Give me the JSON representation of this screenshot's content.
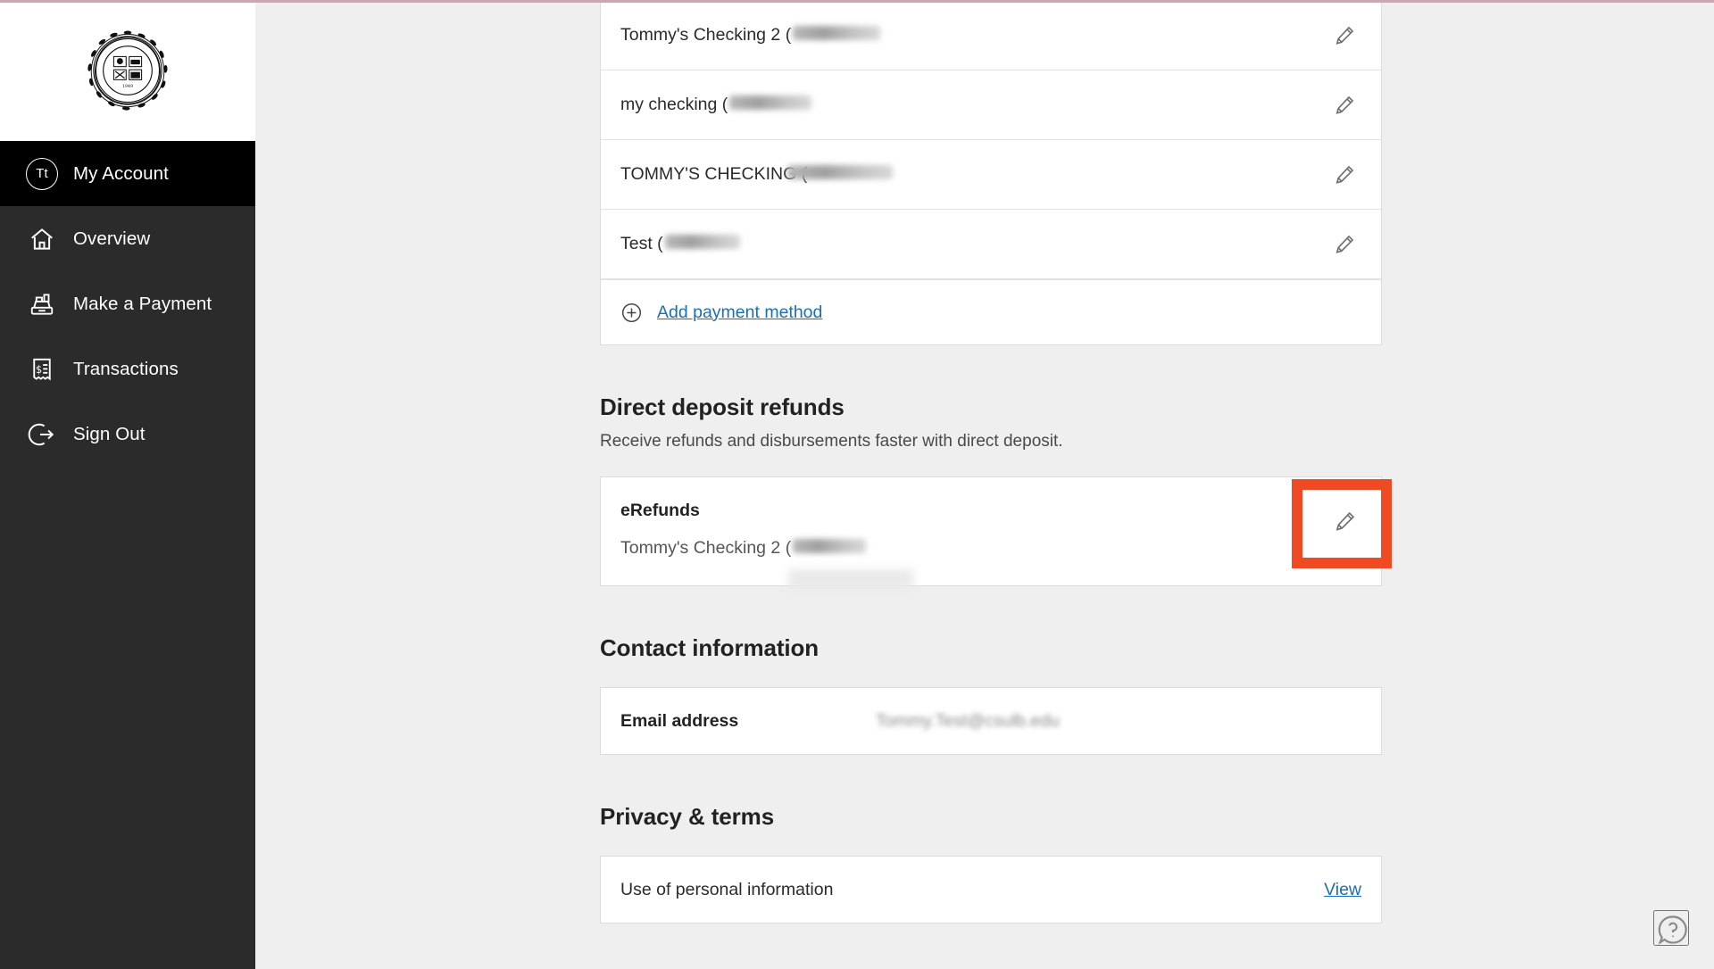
{
  "sidebar": {
    "logo_alt": "California State University Long Beach seal",
    "logo_text_top": "CALIFORNIA STATE UNIVERSITY",
    "logo_text_bottom": "LONG BEACH",
    "logo_year": "1949",
    "items": [
      {
        "label": "My Account",
        "icon": "avatar-icon",
        "badge": "Tt",
        "active": true
      },
      {
        "label": "Overview",
        "icon": "home-icon",
        "active": false
      },
      {
        "label": "Make a Payment",
        "icon": "register-icon",
        "active": false
      },
      {
        "label": "Transactions",
        "icon": "receipt-icon",
        "active": false
      },
      {
        "label": "Sign Out",
        "icon": "sign-out-icon",
        "active": false
      }
    ]
  },
  "payment_methods": {
    "rows": [
      {
        "name": "Tommy's Checking 2 (",
        "masked": "••••••6789)",
        "edit_icon": "pencil-icon"
      },
      {
        "name": "my checking (",
        "masked": "••••••6235)",
        "edit_icon": "pencil-icon"
      },
      {
        "name": "TOMMY'S CHECKING (",
        "masked": "••••••6789)",
        "edit_icon": "pencil-icon"
      },
      {
        "name": "Test (",
        "masked": "••••••3304)",
        "edit_icon": "pencil-icon"
      }
    ],
    "add_label": "Add payment method",
    "add_icon": "plus-circle-icon"
  },
  "direct_deposit": {
    "title": "Direct deposit refunds",
    "subtitle": "Receive refunds and disbursements faster with direct deposit.",
    "account_title": "eRefunds",
    "account_name": "Tommy's Checking 2 (",
    "account_masked": "•••••6789)",
    "edit_icon": "pencil-icon"
  },
  "contact": {
    "title": "Contact information",
    "email_label": "Email address",
    "email_value": "Tommy.Test@csulb.edu"
  },
  "privacy": {
    "title": "Privacy & terms",
    "row_label": "Use of personal information",
    "view_label": "View"
  },
  "help": {
    "icon": "help-question-icon",
    "label": "Help"
  },
  "colors": {
    "sidebar_bg": "#2b2b2b",
    "sidebar_active_bg": "#000000",
    "page_bg": "#efefef",
    "card_bg": "#ffffff",
    "link": "#1a6fb5",
    "highlight": "#f04a23",
    "top_rule": "#c9a8b0"
  }
}
